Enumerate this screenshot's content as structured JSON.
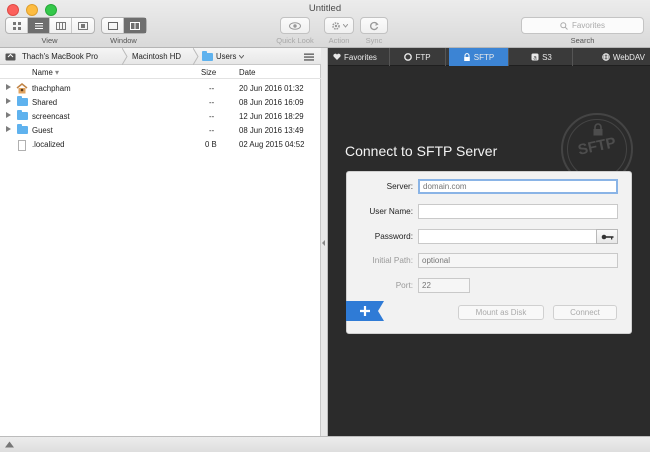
{
  "window": {
    "title": "Untitled"
  },
  "toolbar": {
    "view_label": "View",
    "window_label": "Window",
    "quick_look_label": "Quick Look",
    "action_label": "Action",
    "sync_label": "Sync",
    "search_label": "Search",
    "search_placeholder": "Favorites"
  },
  "browser": {
    "path": [
      "Thach's MacBook Pro",
      "Macintosh HD",
      "Users"
    ],
    "columns": {
      "name": "Name",
      "size": "Size",
      "date": "Date"
    },
    "rows": [
      {
        "name": "thachpham",
        "size": "--",
        "date": "20 Jun 2016 01:32",
        "icon": "home-folder-icon"
      },
      {
        "name": "Shared",
        "size": "--",
        "date": "08 Jun 2016 16:09",
        "icon": "folder-icon"
      },
      {
        "name": "screencast",
        "size": "--",
        "date": "12 Jun 2016 18:29",
        "icon": "folder-icon"
      },
      {
        "name": "Guest",
        "size": "--",
        "date": "08 Jun 2016 13:49",
        "icon": "folder-icon"
      },
      {
        "name": ".localized",
        "size": "0 B",
        "date": "02 Aug 2015 04:52",
        "icon": "file-icon"
      }
    ]
  },
  "connect": {
    "tabs": [
      {
        "label": "Favorites",
        "icon": "heart-icon"
      },
      {
        "label": "FTP",
        "icon": "ftp-icon"
      },
      {
        "label": "SFTP",
        "icon": "lock-icon"
      },
      {
        "label": "S3",
        "icon": "s3-icon"
      },
      {
        "label": "WebDAV",
        "icon": "globe-icon"
      }
    ],
    "active_tab": "SFTP",
    "title": "Connect to SFTP Server",
    "stamp_text": "SFTP",
    "fields": {
      "server_label": "Server:",
      "server_placeholder": "domain.com",
      "username_label": "User Name:",
      "username_value": "",
      "password_label": "Password:",
      "password_value": "",
      "initial_path_label": "Initial Path:",
      "initial_path_placeholder": "optional",
      "port_label": "Port:",
      "port_placeholder": "22"
    },
    "buttons": {
      "mount": "Mount as Disk",
      "connect": "Connect"
    },
    "colors": {
      "accent": "#3c84d4",
      "panel_bg": "#2b2b2b",
      "ribbon": "#2f7bd6"
    }
  }
}
